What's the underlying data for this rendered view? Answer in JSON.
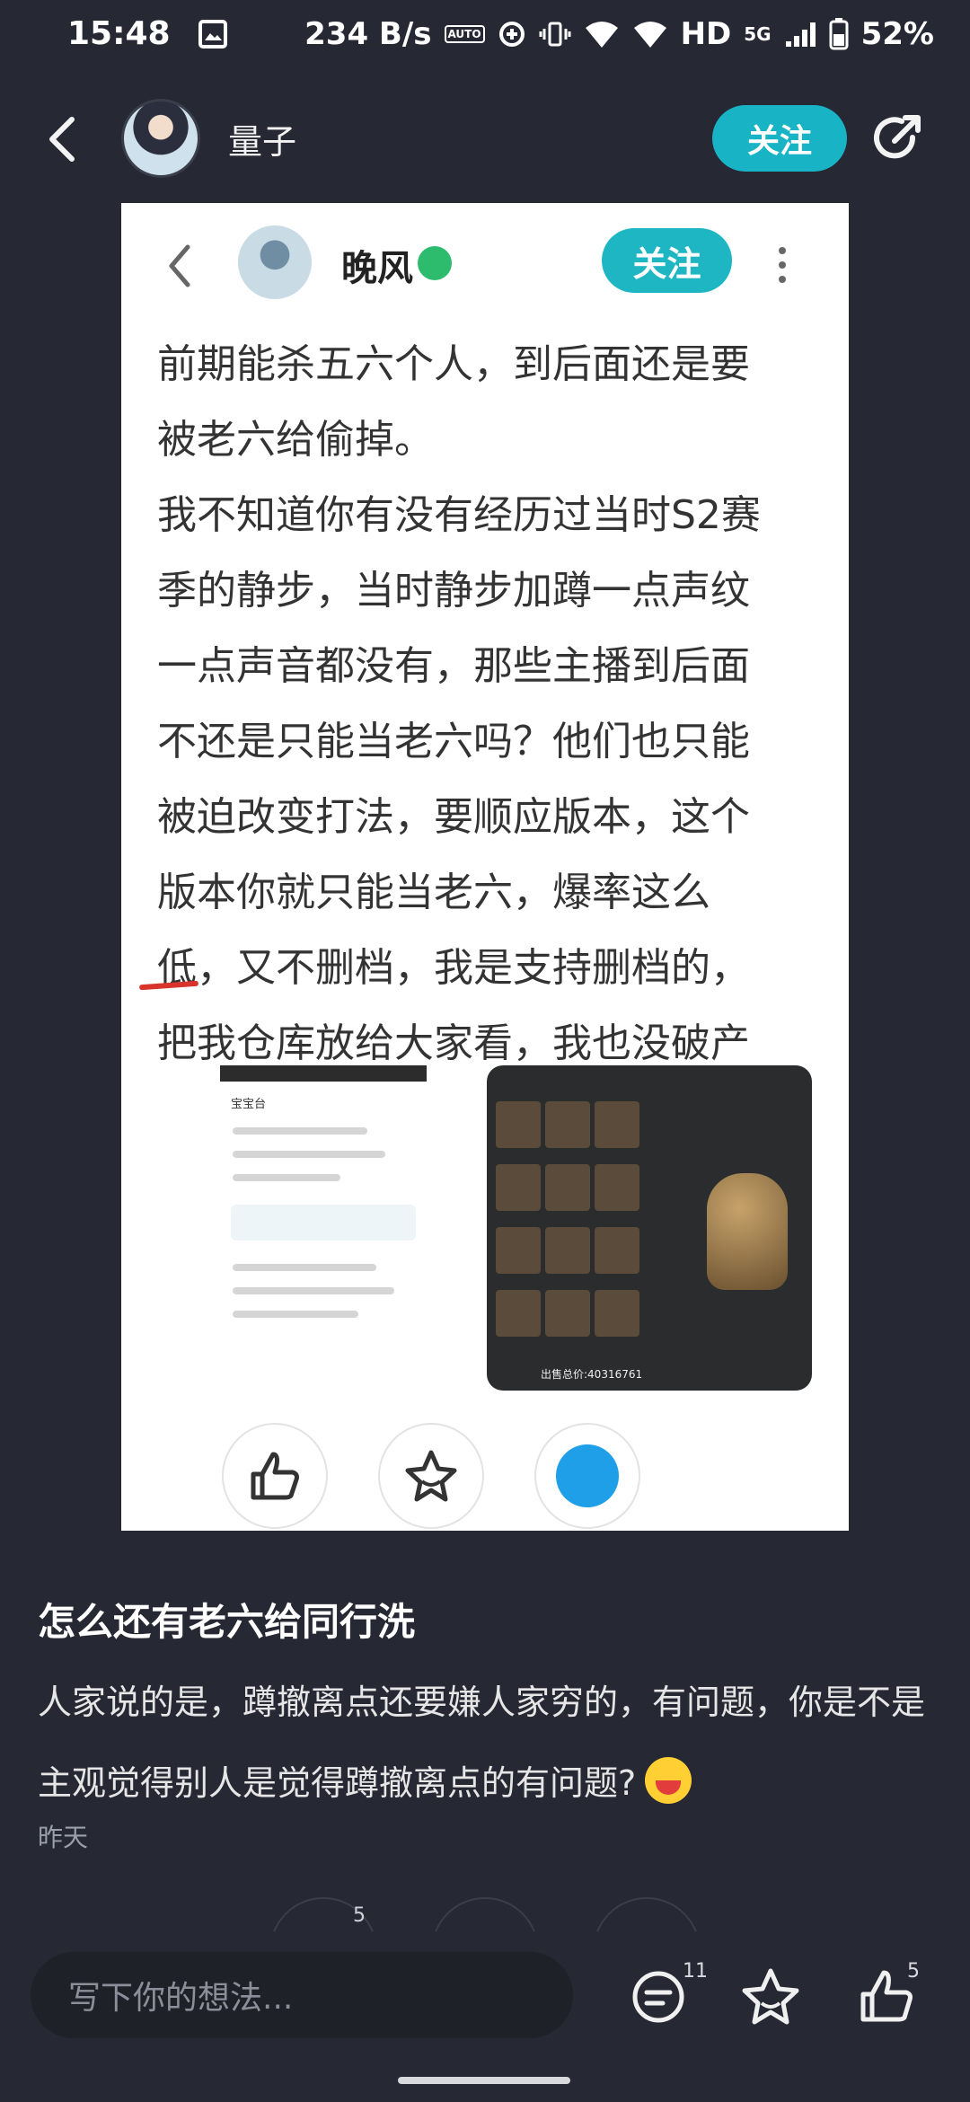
{
  "status_bar": {
    "time": "15:48",
    "network_speed": "234 B/s",
    "auto_label": "AUTO",
    "network_type": "HD",
    "signal": "5G",
    "battery": "52%",
    "icons": [
      "image-icon",
      "auto-hz-icon",
      "target-icon",
      "vibrate-icon",
      "wifi6-icon",
      "wifi-icon",
      "signal-icon",
      "battery-icon"
    ]
  },
  "header": {
    "username": "量子",
    "follow_label": "关注",
    "back_icon": "chevron-left-icon",
    "share_icon": "share-icon"
  },
  "embedded_post": {
    "author": "晚风",
    "follow_label": "关注",
    "lines": [
      "前期能杀五六个人，到后面还是要",
      "被老六给偷掉。",
      "我不知道你有没有经历过当时S2赛",
      "季的静步，当时静步加蹲一点声纹",
      "一点声音都没有，那些主播到后面",
      "不还是只能当老六吗？他们也只能",
      "被迫改变打法，要顺应版本，这个",
      "版本你就只能当老六，爆率这么",
      "低",
      "，又不删档，我是支持删档的，",
      "把我仓库放给大家看，我也没破产"
    ],
    "screenshot_left_title": "宝宝台",
    "screenshot_right_total": "出售总价:40316761",
    "actions": [
      "like-icon",
      "favorite-icon",
      "qq-share-icon"
    ]
  },
  "comment": {
    "title": "怎么还有老六给同行洗",
    "body_line1": "人家说的是，蹲撤离点还要嫌人家穷的，有问题，你是不是",
    "body_line2": "主观觉得别人是觉得蹲撤离点的有问题?",
    "time": "昨天",
    "ghost_count": "5"
  },
  "bottom_bar": {
    "input_placeholder": "写下你的想法...",
    "comment_count": "11",
    "like_count": "5"
  },
  "colors": {
    "background": "#262833",
    "accent": "#19b3c6",
    "strike": "#d9342b"
  }
}
